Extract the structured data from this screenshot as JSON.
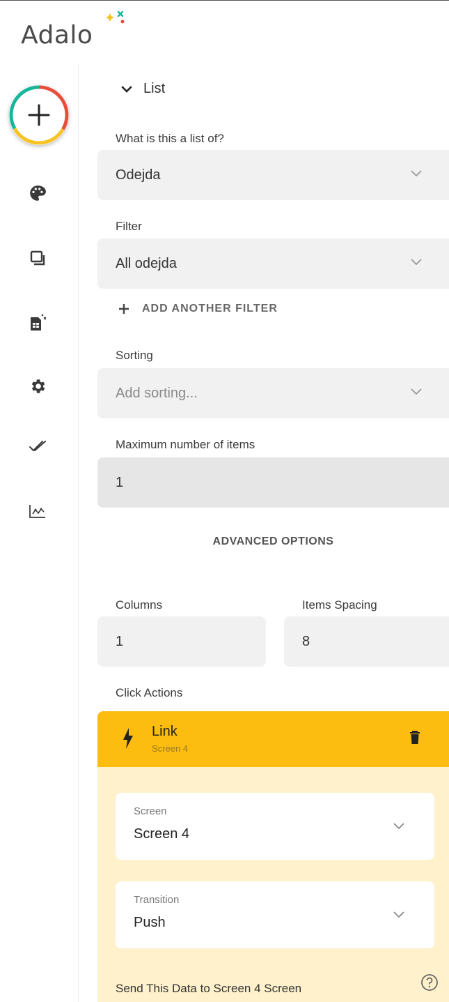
{
  "app": {
    "logo_text": "Adalo"
  },
  "list_section": {
    "title": "List",
    "list_of_label": "What is this a list of?",
    "list_of_value": "Odejda",
    "filter_label": "Filter",
    "filter_value": "All odejda",
    "add_filter_label": "ADD ANOTHER FILTER",
    "sorting_label": "Sorting",
    "sorting_placeholder": "Add sorting...",
    "max_items_label": "Maximum number of items",
    "max_items_value": "1",
    "advanced_label": "ADVANCED OPTIONS",
    "columns_label": "Columns",
    "columns_value": "1",
    "spacing_label": "Items Spacing",
    "spacing_value": "8",
    "click_actions_label": "Click Actions"
  },
  "action": {
    "title": "Link",
    "subtitle": "Screen 4",
    "screen_label": "Screen",
    "screen_value": "Screen 4",
    "transition_label": "Transition",
    "transition_value": "Push",
    "send_data_label": "Send This Data to Screen 4 Screen"
  },
  "sidebar": {
    "icons": [
      "plus-icon",
      "palette-icon",
      "screens-icon",
      "database-icon",
      "gear-icon",
      "check-icon",
      "analytics-icon"
    ]
  },
  "colors": {
    "accent_yellow": "#fcbd10",
    "action_bg": "#fff1cc",
    "ring_red": "#e94e3c",
    "ring_yellow": "#f7c325",
    "ring_teal": "#17b79b"
  }
}
